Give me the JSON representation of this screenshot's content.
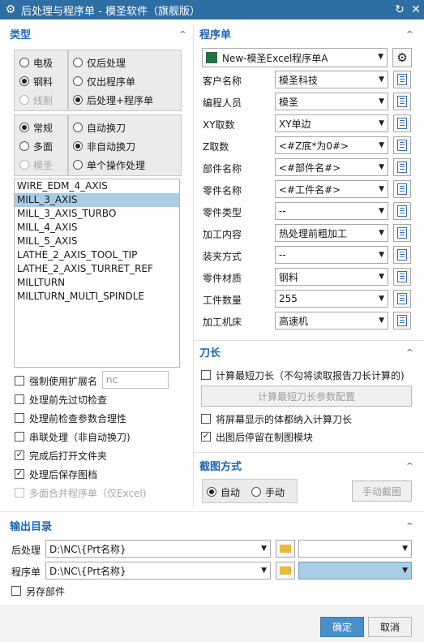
{
  "title": "后处理与程序单 - 模圣软件（旗舰版）",
  "colors": {
    "titlebar": "#2d6ea3",
    "section": "#1e66b5",
    "selected": "#a8cde5",
    "ok_button": "#4a90c8"
  },
  "type_section": {
    "header": "类型",
    "group1_left": [
      "电极",
      "钢料",
      "线割"
    ],
    "group1_right": [
      "仅后处理",
      "仅出程序单",
      "后处理+程序单"
    ],
    "group1_left_selected": "钢料",
    "group1_right_selected": "后处理+程序单",
    "group2_left": [
      "常规",
      "多面",
      "模圣"
    ],
    "group2_right": [
      "自动换刀",
      "非自动换刀",
      "单个操作处理"
    ],
    "group2_left_selected": "常规",
    "group2_right_selected": "非自动换刀",
    "machines": [
      "WIRE_EDM_4_AXIS",
      "MILL_3_AXIS",
      "MILL_3_AXIS_TURBO",
      "MILL_4_AXIS",
      "MILL_5_AXIS",
      "LATHE_2_AXIS_TOOL_TIP",
      "LATHE_2_AXIS_TURRET_REF",
      "MILLTURN",
      "MILLTURN_MULTI_SPINDLE"
    ],
    "machines_selected": "MILL_3_AXIS",
    "force_ext_label": "强制使用扩展名",
    "force_ext_value": "nc",
    "options": [
      {
        "label": "处理前先过切检查",
        "checked": false,
        "disabled": false
      },
      {
        "label": "处理前检查参数合理性",
        "checked": false,
        "disabled": false
      },
      {
        "label": "串联处理（非自动换刀)",
        "checked": false,
        "disabled": false
      },
      {
        "label": "完成后打开文件夹",
        "checked": true,
        "disabled": false
      },
      {
        "label": "处理后保存图档",
        "checked": true,
        "disabled": false
      },
      {
        "label": "多面合并程序单（仅Excel)",
        "checked": false,
        "disabled": true
      }
    ]
  },
  "program_section": {
    "header": "程序单",
    "template": "New-模圣Excel程序单A",
    "fields": [
      {
        "label": "客户名称",
        "value": "模圣科技"
      },
      {
        "label": "编程人员",
        "value": "模圣"
      },
      {
        "label": "XY取数",
        "value": "XY单边"
      },
      {
        "label": "Z取数",
        "value": "<#Z底*为0#>"
      },
      {
        "label": "部件名称",
        "value": "<#部件名#>"
      },
      {
        "label": "零件名称",
        "value": "<#工件名#>"
      },
      {
        "label": "零件类型",
        "value": "--"
      },
      {
        "label": "加工内容",
        "value": "热处理前粗加工"
      },
      {
        "label": "装夹方式",
        "value": "--"
      },
      {
        "label": "零件材质",
        "value": "钢料"
      },
      {
        "label": "工件数量",
        "value": "255"
      },
      {
        "label": "加工机床",
        "value": "高速机"
      }
    ]
  },
  "tool_section": {
    "header": "刀长",
    "calc_shortest": "计算最短刀长（不勾将读取报告刀长计算的)",
    "config_button": "计算最短刀长参数配置",
    "include_bodies": "将屏幕显示的体都纳入计算刀长",
    "stay_drafting": "出图后停留在制图模块",
    "calc_shortest_checked": false,
    "include_bodies_checked": false,
    "stay_drafting_checked": true
  },
  "screenshot_section": {
    "header": "截图方式",
    "auto": "自动",
    "manual": "手动",
    "selected": "自动",
    "manual_button": "手动截图"
  },
  "output_section": {
    "header": "输出目录",
    "post_label": "后处理",
    "post_path": "D:\\NC\\{Prt名称}",
    "sheet_label": "程序单",
    "sheet_path": "D:\\NC\\{Prt名称}",
    "save_part": "另存部件",
    "save_part_checked": false
  },
  "buttons": {
    "ok": "确定",
    "cancel": "取消"
  }
}
